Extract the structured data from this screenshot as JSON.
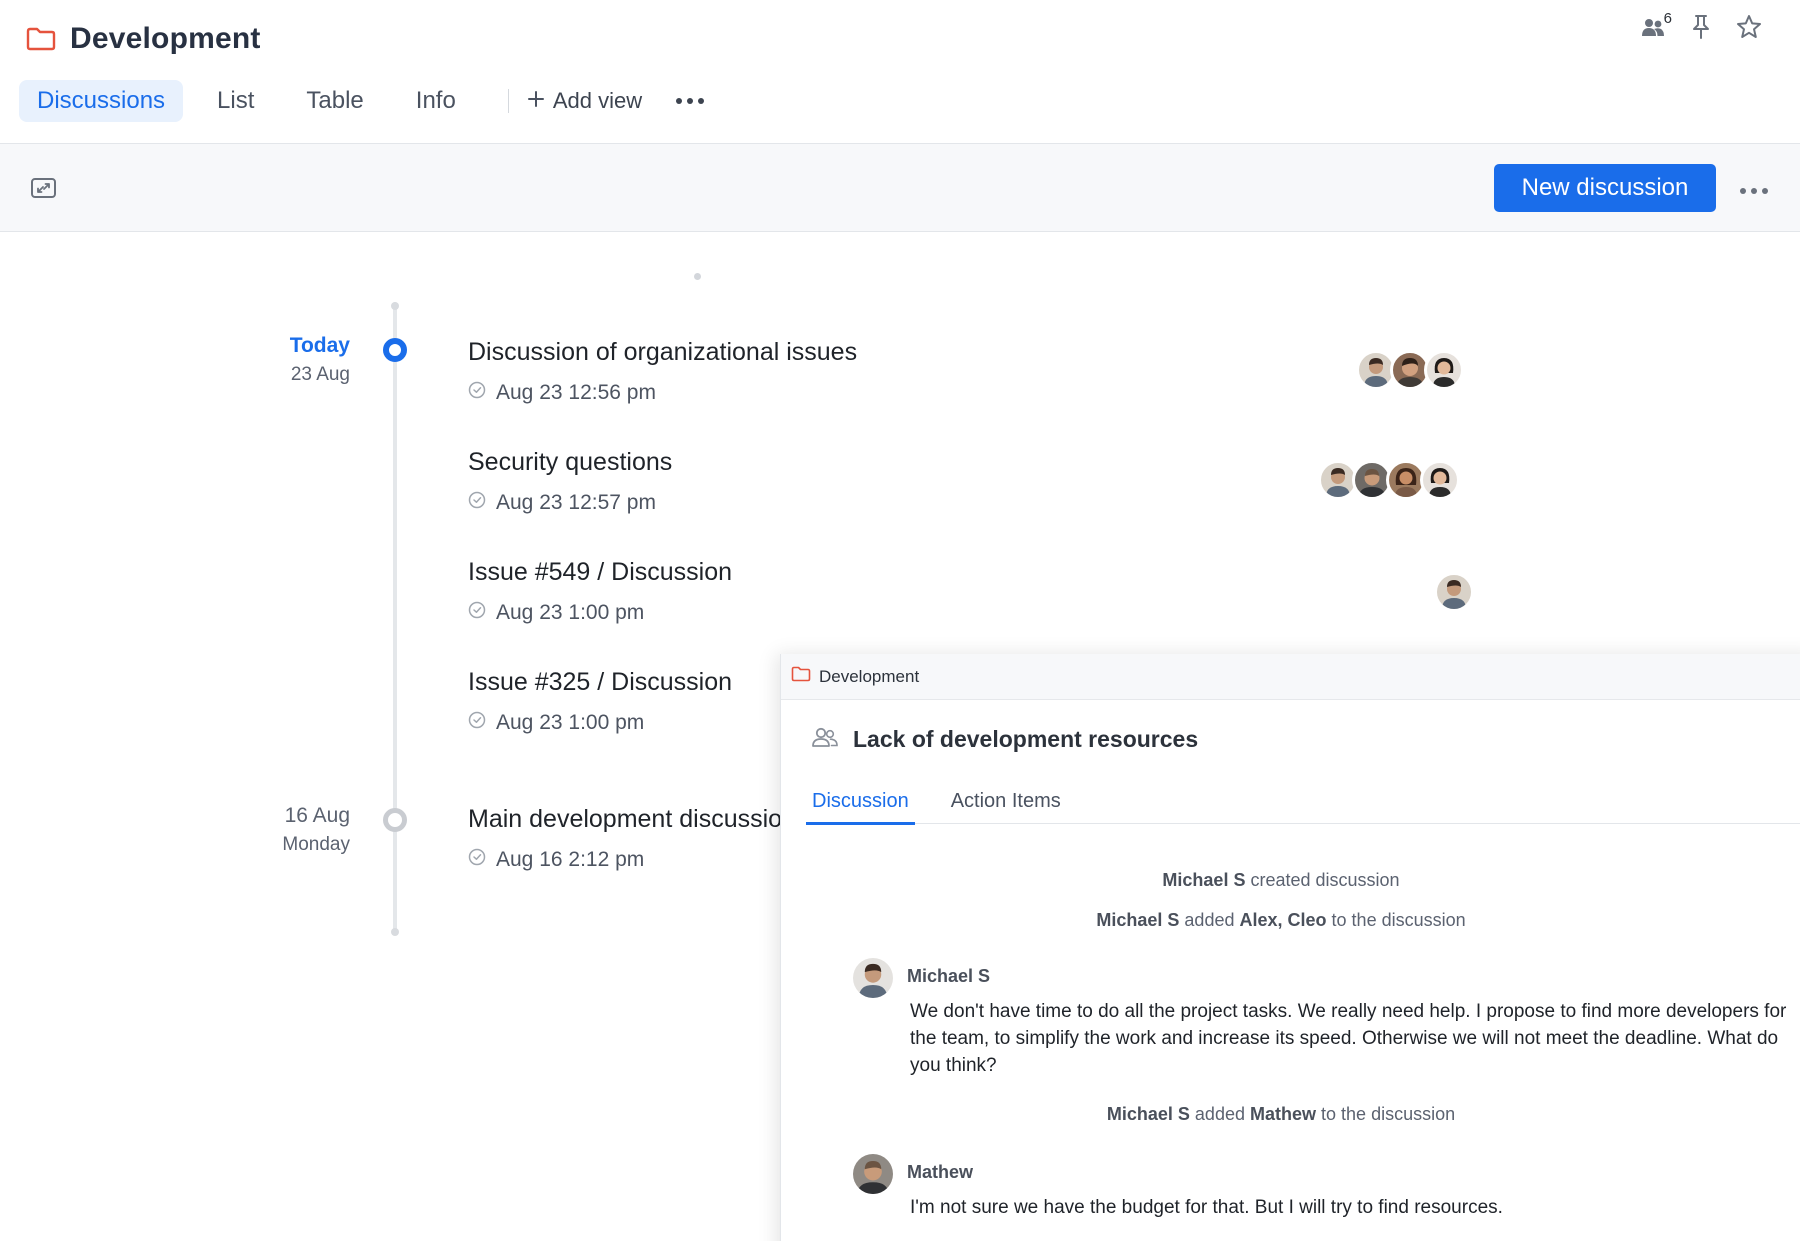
{
  "header": {
    "title": "Development",
    "members_count": "6",
    "tabs": [
      {
        "label": "Discussions",
        "active": true
      },
      {
        "label": "List",
        "active": false
      },
      {
        "label": "Table",
        "active": false
      },
      {
        "label": "Info",
        "active": false
      }
    ],
    "add_view_label": "Add view"
  },
  "toolbar": {
    "new_button_label": "New discussion"
  },
  "colors": {
    "accent": "#1a6dea",
    "folder": "#e5533d",
    "active_tab_bg": "#e8f1fd"
  },
  "timeline": {
    "groups": [
      {
        "date_main": "Today",
        "date_sub": "23 Aug",
        "items": [
          {
            "title": "Discussion of organizational issues",
            "time": "Aug 23 12:56 pm"
          },
          {
            "title": "Security questions",
            "time": "Aug 23 12:57 pm"
          },
          {
            "title": "Issue #549 / Discussion",
            "time": "Aug 23 1:00 pm"
          },
          {
            "title": "Issue #325 / Discussion",
            "time": "Aug 23 1:00 pm"
          }
        ]
      },
      {
        "date_main": "16 Aug",
        "date_sub": "Monday",
        "items": [
          {
            "title": "Main development discussion",
            "time": "Aug 16 2:12 pm"
          }
        ]
      }
    ]
  },
  "panel": {
    "breadcrumb": "Development",
    "title": "Lack of development resources",
    "tabs": [
      {
        "label": "Discussion",
        "active": true
      },
      {
        "label": "Action Items",
        "active": false
      }
    ],
    "events": {
      "e1": {
        "actor": "Michael S",
        "text": "created discussion"
      },
      "e2": {
        "actor": "Michael S",
        "text1": "added",
        "targets": "Alex, Cleo",
        "text2": "to the discussion"
      },
      "e3": {
        "actor": "Michael S",
        "text1": "added",
        "targets": "Mathew",
        "text2": "to the discussion"
      }
    },
    "messages": [
      {
        "author": "Michael S",
        "text": "We don't have time to do all the project tasks. We really need help. I propose to find more developers for the team, to simplify the work and increase its speed. Otherwise we will not meet the deadline. What do you think?"
      },
      {
        "author": "Mathew",
        "text": "I'm not sure we have the budget for that. But I will try to find resources."
      }
    ]
  }
}
